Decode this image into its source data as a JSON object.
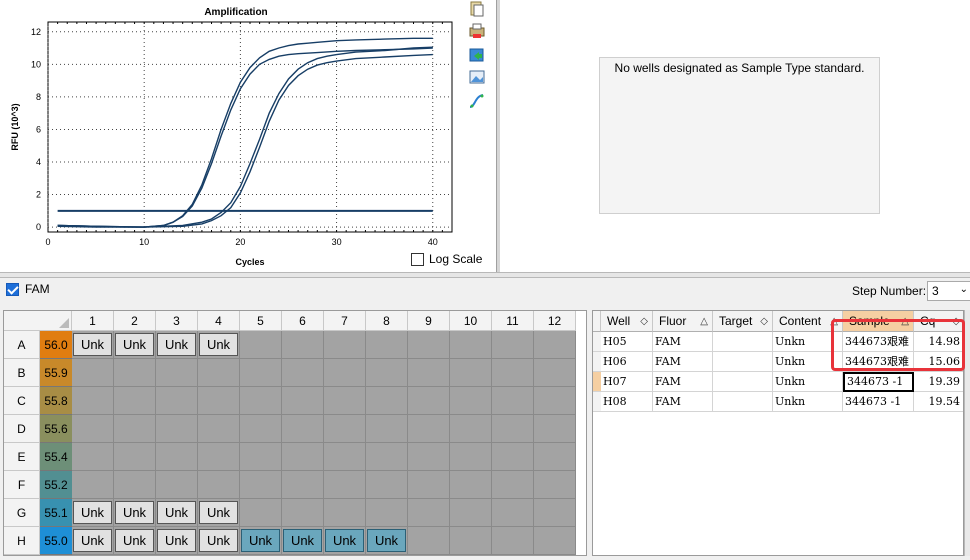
{
  "chart": {
    "title": "Amplification",
    "xlabel": "Cycles",
    "ylabel": "RFU (10^3)",
    "log_scale_label": "Log Scale"
  },
  "chart_data": {
    "type": "line",
    "title": "Amplification",
    "xlabel": "Cycles",
    "ylabel": "RFU (10^3)",
    "xlim": [
      0,
      42
    ],
    "ylim": [
      -0.3,
      12.6
    ],
    "xticks": [
      0,
      10,
      20,
      30,
      40
    ],
    "yticks": [
      0,
      2,
      4,
      6,
      8,
      10,
      12
    ],
    "grid": true,
    "threshold": 1.0,
    "series": [
      {
        "x": [
          1,
          5,
          8,
          10,
          12,
          13,
          14,
          15,
          16,
          17,
          18,
          19,
          20,
          21,
          22,
          23,
          24,
          25,
          26,
          27,
          28,
          30,
          32,
          35,
          38,
          40
        ],
        "y": [
          0.1,
          0.05,
          0.0,
          0.0,
          0.1,
          0.3,
          0.7,
          1.4,
          2.6,
          4.2,
          6.0,
          7.6,
          8.9,
          9.8,
          10.4,
          10.8,
          11.0,
          11.15,
          11.25,
          11.3,
          11.35,
          11.45,
          11.5,
          11.55,
          11.6,
          11.6
        ]
      },
      {
        "x": [
          1,
          5,
          8,
          10,
          12,
          13,
          14,
          15,
          16,
          17,
          18,
          19,
          20,
          21,
          22,
          23,
          24,
          25,
          26,
          28,
          30,
          32,
          35,
          38,
          40
        ],
        "y": [
          0.05,
          0.0,
          0.0,
          0.0,
          0.1,
          0.3,
          0.65,
          1.3,
          2.4,
          3.9,
          5.6,
          7.2,
          8.5,
          9.4,
          10.0,
          10.3,
          10.5,
          10.6,
          10.65,
          10.72,
          10.8,
          10.85,
          10.9,
          10.95,
          11.0
        ]
      },
      {
        "x": [
          1,
          5,
          10,
          14,
          16,
          17,
          18,
          19,
          20,
          21,
          22,
          23,
          24,
          25,
          26,
          27,
          28,
          29,
          30,
          32,
          35,
          38,
          40
        ],
        "y": [
          0.1,
          0.05,
          0.0,
          0.1,
          0.3,
          0.5,
          0.9,
          1.5,
          2.5,
          3.9,
          5.4,
          7.0,
          8.2,
          9.1,
          9.7,
          10.1,
          10.35,
          10.5,
          10.6,
          10.75,
          10.85,
          11.0,
          11.05
        ]
      },
      {
        "x": [
          1,
          5,
          10,
          14,
          16,
          17,
          18,
          19,
          20,
          21,
          22,
          23,
          24,
          25,
          26,
          27,
          28,
          29,
          30,
          32,
          35,
          38,
          40
        ],
        "y": [
          0.1,
          0.05,
          0.0,
          0.05,
          0.2,
          0.4,
          0.7,
          1.2,
          2.1,
          3.4,
          4.9,
          6.5,
          7.8,
          8.7,
          9.3,
          9.7,
          9.95,
          10.1,
          10.2,
          10.35,
          10.45,
          10.55,
          10.6
        ]
      }
    ]
  },
  "standard_curve": {
    "message": "No wells designated as Sample Type standard."
  },
  "fluor": {
    "label": "FAM",
    "step_label": "Step Number:",
    "step_value": "3"
  },
  "plate": {
    "columns": [
      "1",
      "2",
      "3",
      "4",
      "5",
      "6",
      "7",
      "8",
      "9",
      "10",
      "11",
      "12"
    ],
    "rows": [
      {
        "label": "A",
        "temp": "56.0",
        "color": "#e07d10",
        "wells": [
          "Unk",
          "Unk",
          "Unk",
          "Unk",
          "",
          "",
          "",
          "",
          "",
          "",
          "",
          ""
        ]
      },
      {
        "label": "B",
        "temp": "55.9",
        "color": "#c8892a",
        "wells": [
          "",
          "",
          "",
          "",
          "",
          "",
          "",
          "",
          "",
          "",
          "",
          ""
        ]
      },
      {
        "label": "C",
        "temp": "55.8",
        "color": "#a88d45",
        "wells": [
          "",
          "",
          "",
          "",
          "",
          "",
          "",
          "",
          "",
          "",
          "",
          ""
        ]
      },
      {
        "label": "D",
        "temp": "55.6",
        "color": "#8a8f5e",
        "wells": [
          "",
          "",
          "",
          "",
          "",
          "",
          "",
          "",
          "",
          "",
          "",
          ""
        ]
      },
      {
        "label": "E",
        "temp": "55.4",
        "color": "#6d8f78",
        "wells": [
          "",
          "",
          "",
          "",
          "",
          "",
          "",
          "",
          "",
          "",
          "",
          ""
        ]
      },
      {
        "label": "F",
        "temp": "55.2",
        "color": "#528f92",
        "wells": [
          "",
          "",
          "",
          "",
          "",
          "",
          "",
          "",
          "",
          "",
          "",
          ""
        ]
      },
      {
        "label": "G",
        "temp": "55.1",
        "color": "#3891b0",
        "wells": [
          "Unk",
          "Unk",
          "Unk",
          "Unk",
          "",
          "",
          "",
          "",
          "",
          "",
          "",
          ""
        ]
      },
      {
        "label": "H",
        "temp": "55.0",
        "color": "#1e8fd6",
        "wells": [
          "Unk",
          "Unk",
          "Unk",
          "Unk",
          "Unk",
          "Unk",
          "Unk",
          "Unk",
          "",
          "",
          "",
          ""
        ]
      }
    ],
    "selected": [
      "H5",
      "H6",
      "H7",
      "H8"
    ]
  },
  "table": {
    "headers": [
      "Well",
      "Fluor",
      "Target",
      "Content",
      "Sample",
      "Cq"
    ],
    "rows": [
      [
        "H05",
        "FAM",
        "",
        "Unkn",
        "344673艰难",
        "14.98"
      ],
      [
        "H06",
        "FAM",
        "",
        "Unkn",
        "344673艰难",
        "15.06"
      ],
      [
        "H07",
        "FAM",
        "",
        "Unkn",
        "344673 -1",
        "19.39"
      ],
      [
        "H08",
        "FAM",
        "",
        "Unkn",
        "344673 -1",
        "19.54"
      ]
    ]
  }
}
